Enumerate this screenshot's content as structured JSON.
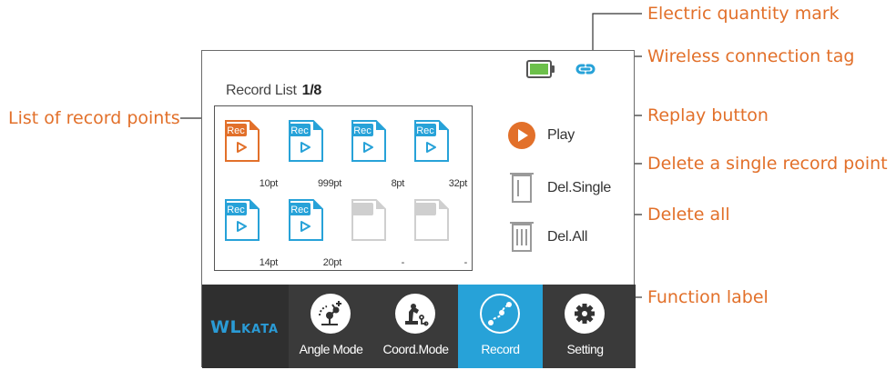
{
  "annotations": {
    "battery": "Electric quantity mark",
    "wireless": "Wireless connection tag",
    "record_list": "List of record points",
    "replay": "Replay button",
    "delete_single": "Delete a single record point",
    "delete_all": "Delete all",
    "function_label": "Function label"
  },
  "record_list": {
    "title": "Record List",
    "page": "1/8",
    "items": [
      {
        "tag": "Rec",
        "points": "10pt",
        "state": "selected"
      },
      {
        "tag": "Rec",
        "points": "999pt",
        "state": "filled"
      },
      {
        "tag": "Rec",
        "points": "8pt",
        "state": "filled"
      },
      {
        "tag": "Rec",
        "points": "32pt",
        "state": "filled"
      },
      {
        "tag": "Rec",
        "points": "14pt",
        "state": "filled"
      },
      {
        "tag": "Rec",
        "points": "20pt",
        "state": "filled"
      },
      {
        "tag": "",
        "points": "-",
        "state": "empty"
      },
      {
        "tag": "",
        "points": "-",
        "state": "empty"
      }
    ]
  },
  "actions": {
    "play": "Play",
    "delete_single": "Del.Single",
    "delete_all": "Del.All"
  },
  "tabbar": {
    "logo_main": "WL",
    "logo_small": "KATA",
    "tabs": [
      {
        "label": "Angle Mode",
        "icon": "robot-arm-angle-icon"
      },
      {
        "label": "Coord.Mode",
        "icon": "robot-arm-coord-icon"
      },
      {
        "label": "Record",
        "icon": "record-path-icon",
        "active": true
      },
      {
        "label": "Setting",
        "icon": "gear-icon"
      }
    ]
  },
  "colors": {
    "annotation": "#e2702a",
    "accent_blue": "#27a2d8",
    "selected_orange": "#e2702a",
    "battery_green": "#6cc04a",
    "empty_gray": "#cfcfcf",
    "tabbar_bg": "#3a3a3a"
  }
}
